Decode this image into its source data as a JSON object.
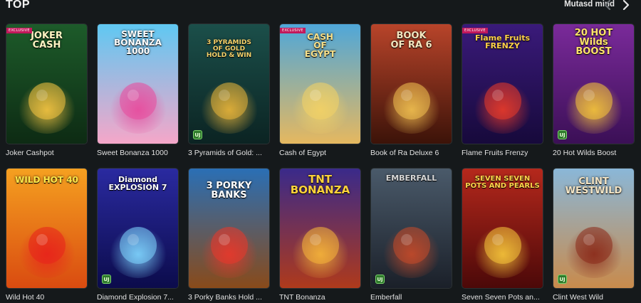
{
  "header": {
    "title": "TOP",
    "view_all": "Mutasd mind",
    "prev_icon": "chevron-left-icon",
    "next_icon": "chevron-right-icon"
  },
  "games": [
    {
      "name": "Joker Cashpot",
      "logo": "JOKER\nCASH",
      "exclusive": "EXCLUSIVE",
      "badge": "",
      "bg1": "#1d5b2a",
      "bg2": "#0d2a13",
      "accent": "#f5c542"
    },
    {
      "name": "Sweet Bonanza 1000",
      "logo": "SWEET\nBONANZA\n1000",
      "exclusive": "",
      "badge": "",
      "bg1": "#5fc8f2",
      "bg2": "#f7a6c8",
      "accent": "#e84a9c"
    },
    {
      "name": "3 Pyramids of Gold: ...",
      "logo": "3 PYRAMIDS\nOF GOLD\nHOLD & WIN",
      "exclusive": "",
      "badge": "UJ",
      "bg1": "#1b4f4a",
      "bg2": "#0b2322",
      "accent": "#e8b43a"
    },
    {
      "name": "Cash of Egypt",
      "logo": "CASH\nOF\nEGYPT",
      "exclusive": "EXCLUSIVE",
      "badge": "",
      "bg1": "#4fa7d9",
      "bg2": "#e7b85e",
      "accent": "#f3d266"
    },
    {
      "name": "Book of Ra Deluxe 6",
      "logo": "BOOK\nOF RA 6",
      "exclusive": "",
      "badge": "",
      "bg1": "#b8442a",
      "bg2": "#3a1208",
      "accent": "#f0c050"
    },
    {
      "name": "Flame Fruits Frenzy",
      "logo": "Flame Fruits\nFRENZY",
      "exclusive": "EXCLUSIVE",
      "badge": "",
      "bg1": "#3a1a7a",
      "bg2": "#16093a",
      "accent": "#e83a2a"
    },
    {
      "name": "20 Hot Wilds Boost",
      "logo": "20 HOT\nWilds\nBOOST",
      "exclusive": "",
      "badge": "UJ",
      "bg1": "#7a2a9a",
      "bg2": "#3a0f55",
      "accent": "#f5c53a"
    },
    {
      "name": "Wild Hot 40",
      "logo": "WILD HOT 40",
      "exclusive": "",
      "badge": "",
      "bg1": "#f5a020",
      "bg2": "#d94a10",
      "accent": "#e8231c"
    },
    {
      "name": "Diamond Explosion 7...",
      "logo": "Diamond\nEXPLOSION 7",
      "exclusive": "",
      "badge": "UJ",
      "bg1": "#2a2aa0",
      "bg2": "#0b0b4a",
      "accent": "#7fd6ff"
    },
    {
      "name": "3 Porky Banks Hold ...",
      "logo": "3 PORKY\nBANKS",
      "exclusive": "",
      "badge": "",
      "bg1": "#2a6fb5",
      "bg2": "#8a4a18",
      "accent": "#e8382c"
    },
    {
      "name": "TNT Bonanza",
      "logo": "TNT\nBONANZA",
      "exclusive": "",
      "badge": "",
      "bg1": "#3a2a8a",
      "bg2": "#b03a1a",
      "accent": "#f5b53a"
    },
    {
      "name": "Emberfall",
      "logo": "EMBERFALL",
      "exclusive": "",
      "badge": "UJ",
      "bg1": "#4a5a6a",
      "bg2": "#1a1f28",
      "accent": "#c44a2a"
    },
    {
      "name": "Seven Seven Pots an...",
      "logo": "SEVEN SEVEN\nPOTS AND PEARLS",
      "exclusive": "",
      "badge": "",
      "bg1": "#b5281c",
      "bg2": "#4a0808",
      "accent": "#f5c53a"
    },
    {
      "name": "Clint West Wild",
      "logo": "CLINT\nWESTWILD",
      "exclusive": "",
      "badge": "UJ",
      "bg1": "#8ab7d8",
      "bg2": "#c98a4a",
      "accent": "#8a2a1a"
    }
  ]
}
